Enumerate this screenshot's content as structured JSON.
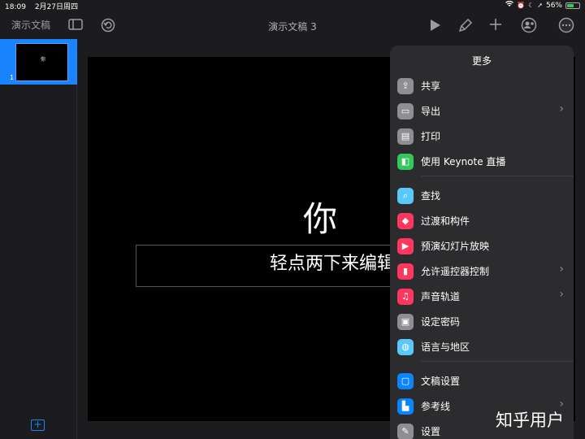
{
  "status": {
    "time": "18:09",
    "date": "2月27日周四",
    "battery": "56%",
    "battery_level": 0.56
  },
  "toolbar": {
    "docs_label": "演示文稿",
    "title": "演示文稿 3"
  },
  "sidebar": {
    "slide_number": "1",
    "slide_thumb_text": "你"
  },
  "slide": {
    "title": "你",
    "subtitle": "轻点两下来编辑"
  },
  "menu": {
    "title": "更多",
    "items": [
      {
        "label": "共享",
        "color": "#8e8e93",
        "icon": "share-icon"
      },
      {
        "label": "导出",
        "color": "#8e8e93",
        "icon": "export-icon"
      },
      {
        "label": "打印",
        "color": "#8e8e93",
        "icon": "print-icon"
      },
      {
        "label": "使用 Keynote 直播",
        "color": "#34c759",
        "icon": "keynote-live-icon"
      },
      {
        "label": "查找",
        "color": "#5ac8fa",
        "icon": "search-icon"
      },
      {
        "label": "过渡和构件",
        "color": "#ff375f",
        "icon": "transition-icon"
      },
      {
        "label": "预演幻灯片放映",
        "color": "#ff375f",
        "icon": "rehearse-icon"
      },
      {
        "label": "允许遥控器控制",
        "color": "#ff375f",
        "icon": "remote-icon"
      },
      {
        "label": "声音轨道",
        "color": "#ff375f",
        "icon": "music-icon"
      },
      {
        "label": "设定密码",
        "color": "#8e8e93",
        "icon": "lock-icon"
      },
      {
        "label": "语言与地区",
        "color": "#5ac8fa",
        "icon": "globe-icon"
      },
      {
        "label": "文稿设置",
        "color": "#0a84ff",
        "icon": "document-setup-icon"
      },
      {
        "label": "参考线",
        "color": "#0a84ff",
        "icon": "guides-icon"
      },
      {
        "label": "设置",
        "color": "#8e8e93",
        "icon": "settings-icon"
      }
    ]
  },
  "watermark": "知乎用户"
}
